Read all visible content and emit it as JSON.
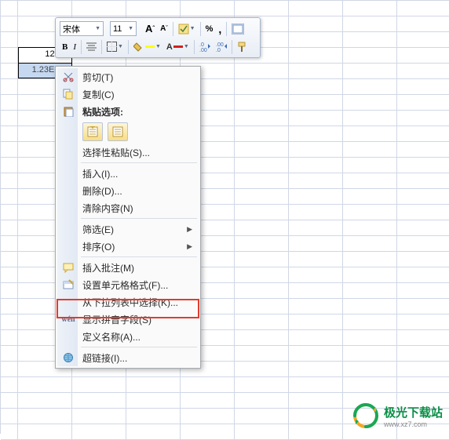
{
  "cells": {
    "a1": "12345",
    "a2": "1.23E+04"
  },
  "toolbar": {
    "font_name": "宋体",
    "font_size": "11",
    "grow_font": "A",
    "shrink_font": "A",
    "bold": "B",
    "italic": "I",
    "percent": "%",
    "comma": ",",
    "inc_dec": "◧",
    "dec_dec": "◨"
  },
  "ctx": {
    "cut": "剪切(T)",
    "copy": "复制(C)",
    "paste_header": "粘贴选项:",
    "paste_special": "选择性粘贴(S)...",
    "insert": "插入(I)...",
    "delete": "删除(D)...",
    "clear": "清除内容(N)",
    "filter": "筛选(E)",
    "sort": "排序(O)",
    "comment": "插入批注(M)",
    "format_cells": "设置单元格格式(F)...",
    "dropdown": "从下拉列表中选择(K)...",
    "phonetic": "显示拼音字段(S)",
    "define_name": "定义名称(A)...",
    "hyperlink": "超链接(I)..."
  },
  "logo": {
    "text": "极光下载站",
    "url": "www.xz7.com"
  }
}
